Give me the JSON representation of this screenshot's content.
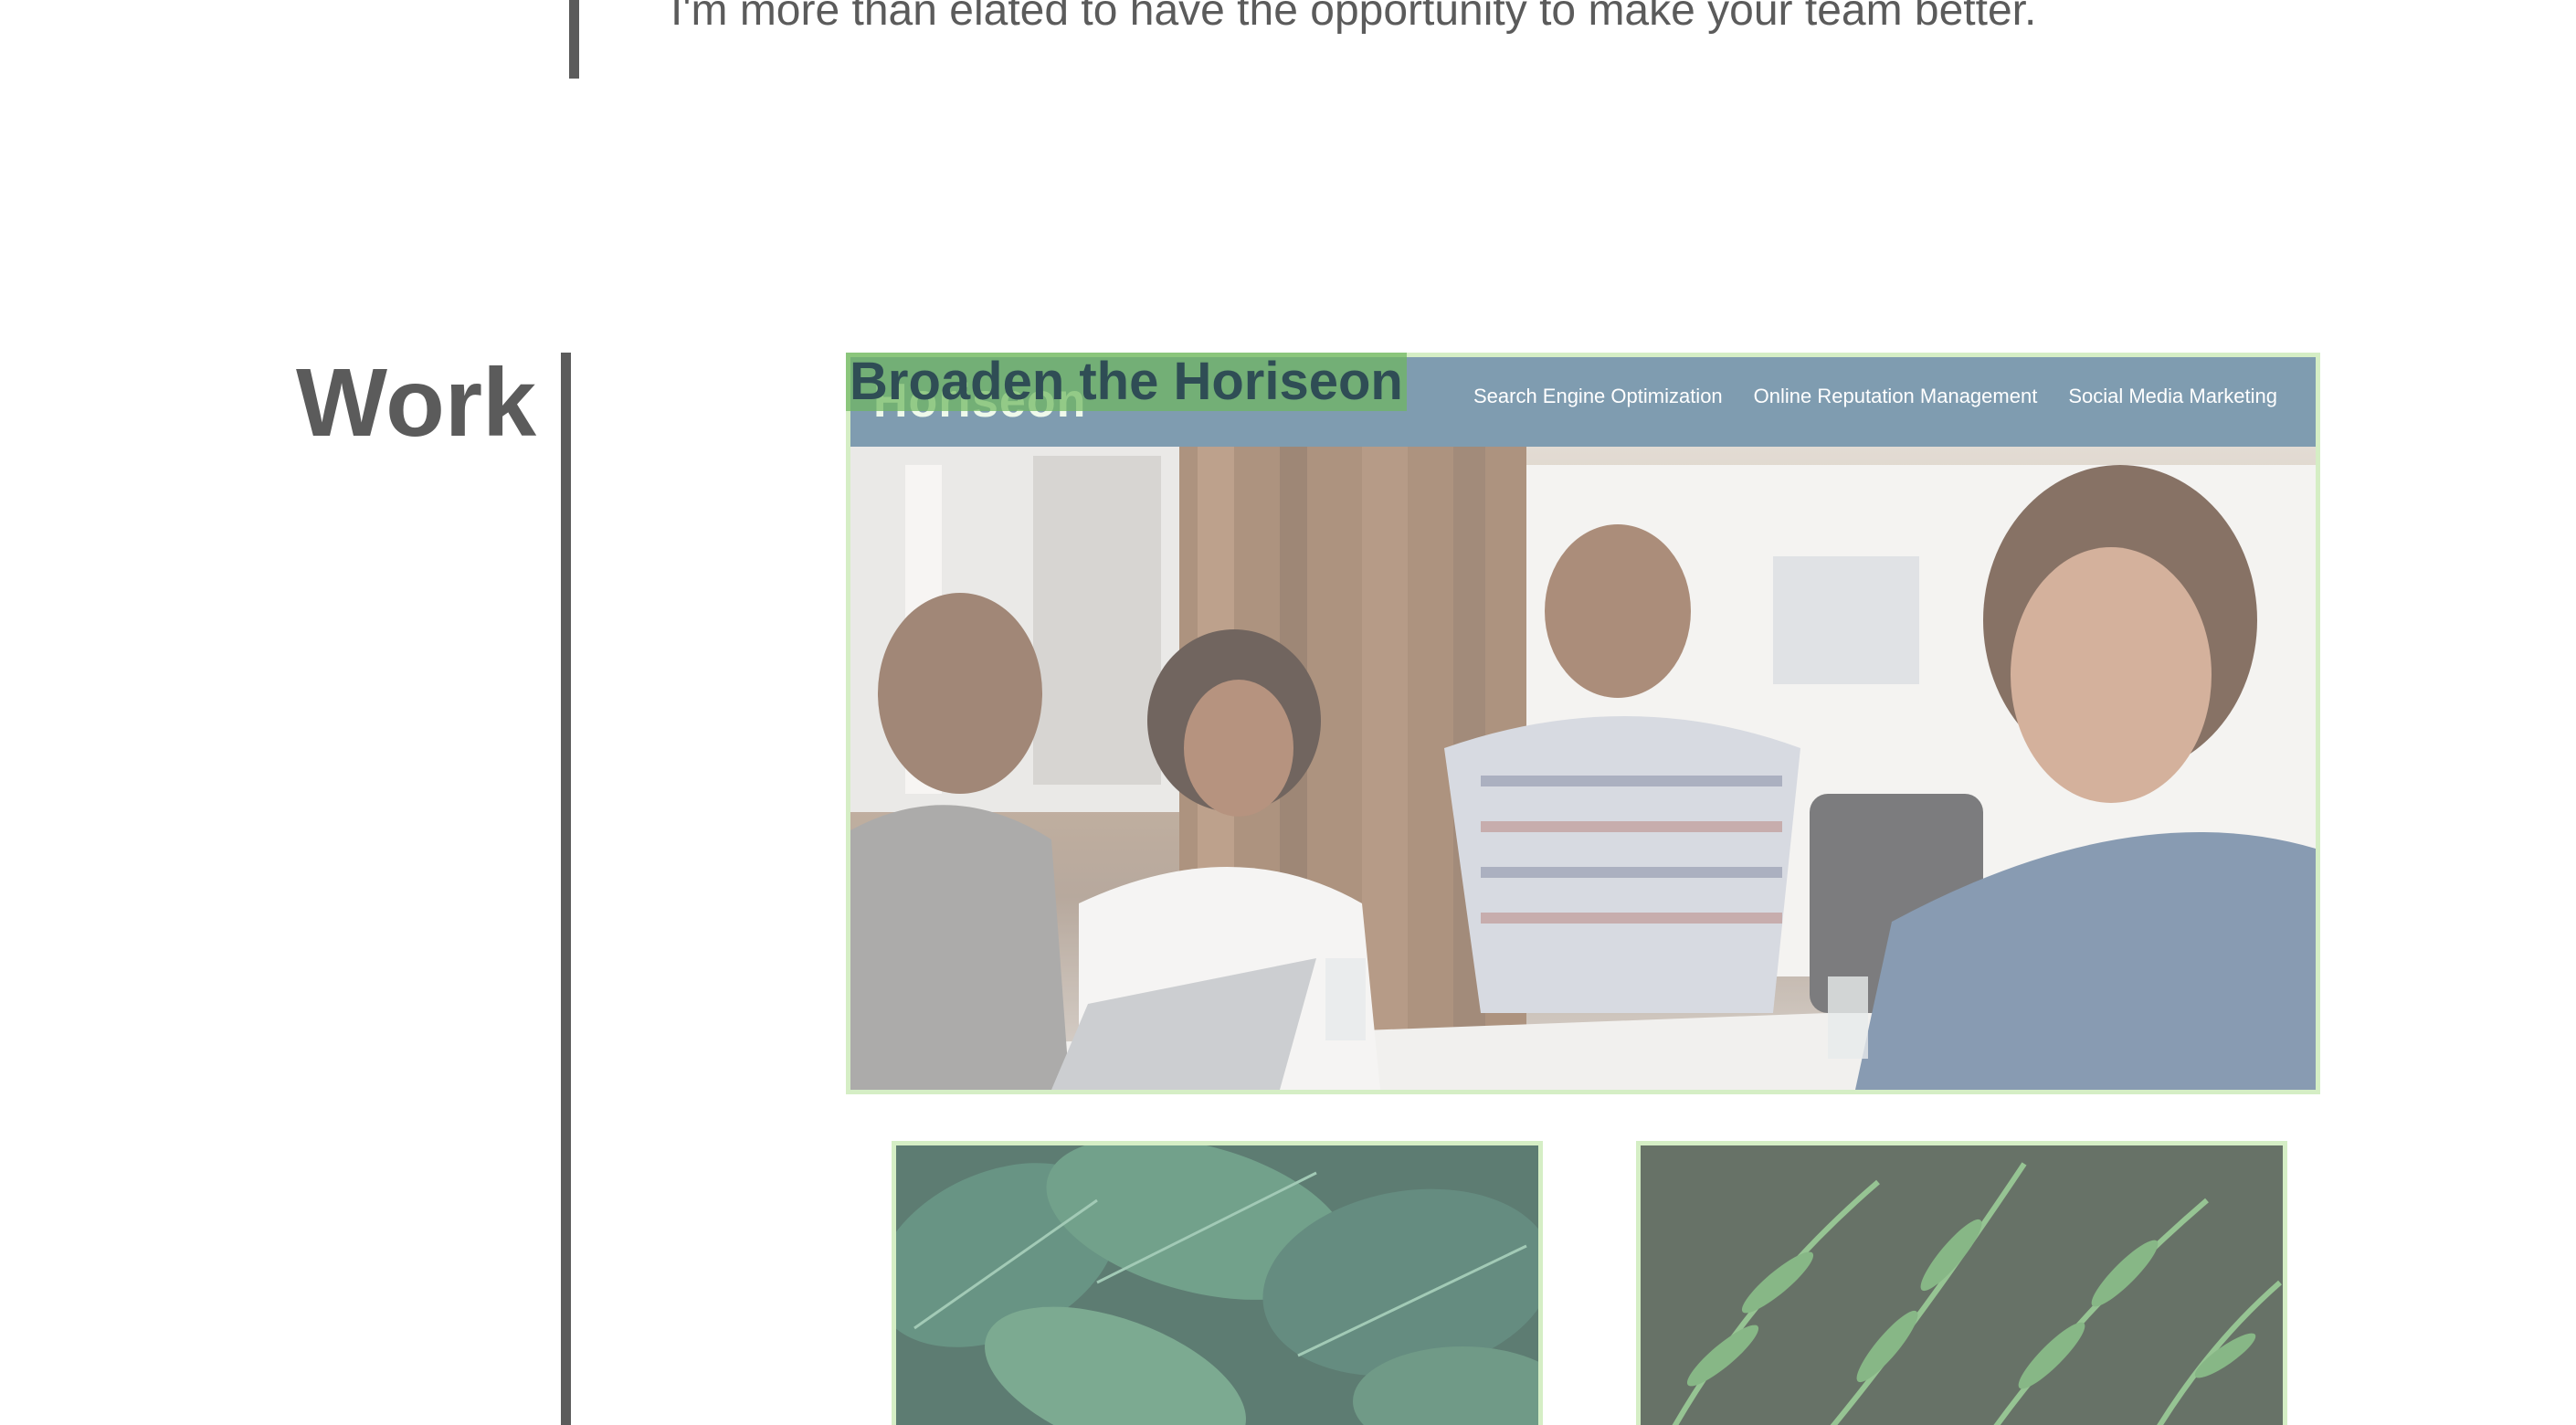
{
  "about": {
    "text": "I'm more than elated to have the opportunity to make your team better."
  },
  "work": {
    "heading": "Work",
    "featured": {
      "title": "Broaden the Horiseon",
      "screenshot": {
        "logo": "Horiseon",
        "nav": [
          "Search Engine Optimization",
          "Online Reputation Management",
          "Social Media Marketing"
        ]
      }
    }
  },
  "colors": {
    "text": "#5b5b5b",
    "card_border": "#c5e8b0",
    "title_highlight": "#6fb760",
    "site_header": "#4f7793"
  },
  "icons": {
    "featured_image": "meeting-photo",
    "project_2_image": "tropical-leaves-photo",
    "project_3_image": "fern-leaves-photo"
  }
}
